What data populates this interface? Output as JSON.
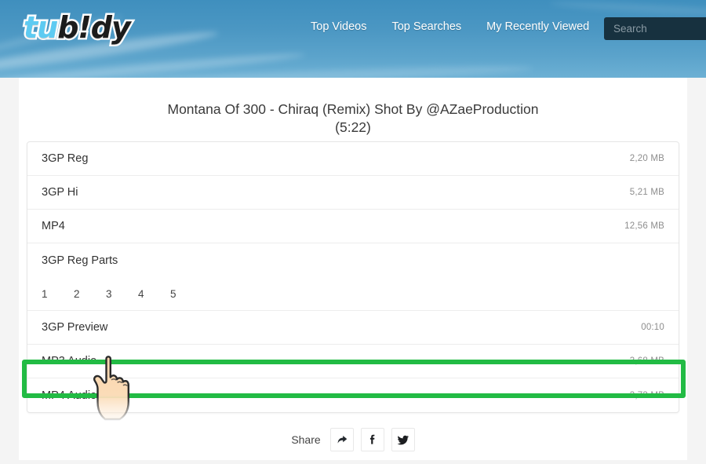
{
  "header": {
    "logo": {
      "light_part": "tu",
      "dark_part": "b!dy",
      "full": "tubidy"
    },
    "nav": [
      {
        "label": "Top Videos",
        "name": "nav-top-videos"
      },
      {
        "label": "Top Searches",
        "name": "nav-top-searches"
      },
      {
        "label": "My Recently Viewed",
        "name": "nav-my-recently-viewed"
      }
    ],
    "search": {
      "placeholder": "Search",
      "value": ""
    },
    "colors": {
      "sky_top": "#3f8fbe",
      "sky_bottom": "#6cb0d4",
      "search_bg": "#17313f"
    }
  },
  "page": {
    "title": "Montana Of 300 - Chiraq (Remix) Shot By @AZaeProduction (5:22)",
    "title_line1": "Montana Of 300 - Chiraq (Remix) Shot By @AZaeProduction",
    "title_line2": "(5:22)"
  },
  "downloads": {
    "rows": [
      {
        "label": "3GP Reg",
        "meta": "2,20 MB",
        "name": "download-row-3gp-reg"
      },
      {
        "label": "3GP Hi",
        "meta": "5,21 MB",
        "name": "download-row-3gp-hi"
      },
      {
        "label": "MP4",
        "meta": "12,56 MB",
        "name": "download-row-mp4"
      },
      {
        "label": "3GP Reg Parts",
        "meta": "",
        "name": "download-row-3gp-reg-parts"
      },
      {
        "label": "3GP Preview",
        "meta": "00:10",
        "name": "download-row-3gp-preview"
      },
      {
        "label": "MP3 Audio",
        "meta": "3,68 MB",
        "name": "download-row-mp3-audio"
      },
      {
        "label": "MP4 Audio",
        "meta": "3,73 MB",
        "name": "download-row-mp4-audio"
      }
    ],
    "parts": [
      "1",
      "2",
      "3",
      "4",
      "5"
    ]
  },
  "highlight": {
    "target_label": "MP3 Audio",
    "color": "#22bb44"
  },
  "share": {
    "label": "Share",
    "buttons": [
      {
        "icon": "share-arrow-icon",
        "name": "share-generic-button"
      },
      {
        "icon": "facebook-icon",
        "name": "share-facebook-button"
      },
      {
        "icon": "twitter-icon",
        "name": "share-twitter-button"
      }
    ]
  },
  "cursor": {
    "icon": "pointing-hand-cursor",
    "skin": "#fbd6ac"
  }
}
